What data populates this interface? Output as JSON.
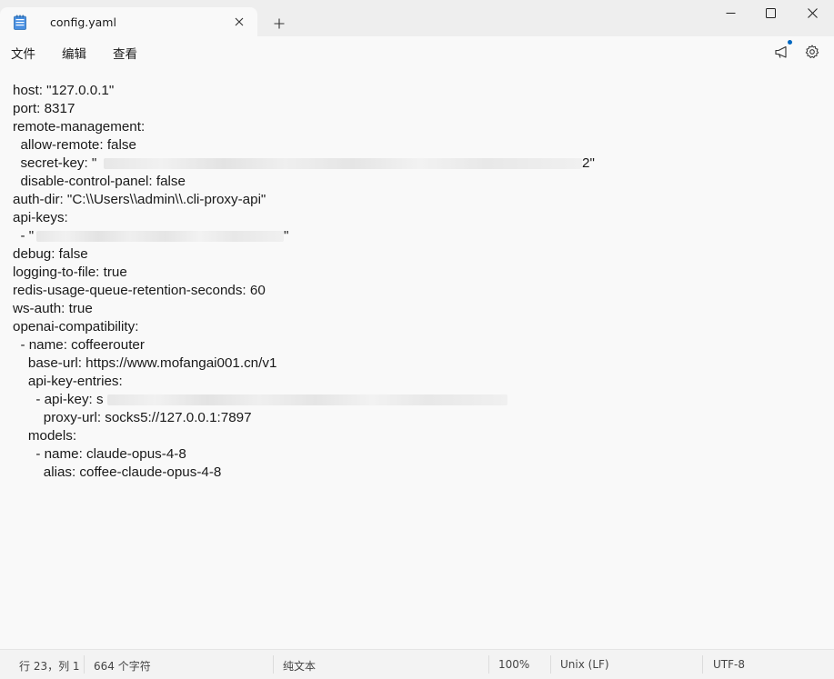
{
  "tab": {
    "title": "config.yaml",
    "new_tab_label": "+"
  },
  "menu": {
    "file": "文件",
    "edit": "编辑",
    "view": "查看"
  },
  "editor": {
    "lines": [
      "host: \"127.0.0.1\"",
      "port: 8317",
      "remote-management:",
      "  allow-remote: false",
      "  secret-key: \"",
      "  disable-control-panel: false",
      "auth-dir: \"C:\\\\Users\\\\admin\\\\.cli-proxy-api\"",
      "api-keys:",
      "  - \"",
      "debug: false",
      "logging-to-file: true",
      "redis-usage-queue-retention-seconds: 60",
      "ws-auth: true",
      "openai-compatibility:",
      "  - name: coffeerouter",
      "    base-url: https://www.mofangai001.cn/v1",
      "    api-key-entries:",
      "      - api-key: s",
      "        proxy-url: socks5://127.0.0.1:7897",
      "    models:",
      "      - name: claude-opus-4-8",
      "        alias: coffee-claude-opus-4-8"
    ],
    "secret_key_tail": "2\"",
    "api_key_tail": "\""
  },
  "status": {
    "position": "行 23，列 1",
    "char_count": "664 个字符",
    "format": "纯文本",
    "zoom": "100%",
    "line_ending": "Unix (LF)",
    "encoding": "UTF-8"
  },
  "colors": {
    "accent": "#0067c0",
    "titlebar_bg": "#eeeeee",
    "editor_bg": "#f9f9f9"
  },
  "icons": [
    "notepad-icon",
    "close-icon",
    "plus-icon",
    "minimize-icon",
    "maximize-icon",
    "announcement-icon",
    "gear-icon"
  ]
}
